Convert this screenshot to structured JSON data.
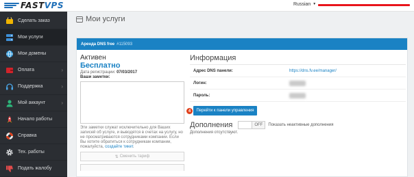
{
  "brand": {
    "logo_prefix": "FAST",
    "logo_suffix": "VPS",
    "accent": "#1a82c4",
    "sidebar_bg": "#2b2e33"
  },
  "header": {
    "language": "Russian",
    "language_caret": "▼"
  },
  "sidebar": {
    "items": [
      {
        "label": "Сделать заказ",
        "icon": "cart-icon",
        "chevron": ""
      },
      {
        "label": "Мои услуги",
        "icon": "server-icon",
        "chevron": ""
      },
      {
        "label": "Мои домены",
        "icon": "globe-icon",
        "chevron": ""
      },
      {
        "label": "Оплата",
        "icon": "wallet-icon",
        "chevron": "›"
      },
      {
        "label": "Поддержка",
        "icon": "headset-icon",
        "chevron": "›"
      },
      {
        "label": "Мой аккаунт",
        "icon": "user-icon",
        "chevron": "›"
      },
      {
        "label": "Начало работы",
        "icon": "rocket-icon",
        "chevron": ""
      },
      {
        "label": "Справка",
        "icon": "lifebuoy-icon",
        "chevron": ""
      },
      {
        "label": "Тех. работы",
        "icon": "gear-icon",
        "chevron": ""
      },
      {
        "label": "Подать жалобу",
        "icon": "thumbs-down-icon",
        "chevron": ""
      }
    ]
  },
  "main": {
    "page_title": "Мои услуги",
    "panel": {
      "heading_service": "Аренда DNS free",
      "heading_id": "#115093",
      "status": "Активен",
      "plan": "Бесплатно",
      "reg_label": "Дата регистрации:",
      "reg_date": "07/03/2017",
      "notes_label": "Ваши заметки:",
      "notes_value": "",
      "notes_help": "Эти заметки служат исключительно для Ваших записей об услуге, и выводятся в счетах на услугу, но не просматриваются сотрудниками компании. Если Вы хотите обратиться к сотрудникам компании, пожалуйста,",
      "notes_help_link": "создайте тикет",
      "notes_help_end": ".",
      "change_plan_label": "Сменить тариф",
      "change_plan_arrow": "⇅",
      "info_title": "Информация",
      "rows": [
        {
          "key": "Адрес DNS панели:",
          "value": "https://dns.fv.ee/manager/"
        },
        {
          "key": "Логин:",
          "value": ""
        },
        {
          "key": "Пароль:",
          "value": ""
        }
      ],
      "panel_button_badge": "4",
      "panel_button_label": "Перейти к панели управления",
      "addons_title": "Дополнения",
      "toggle_state": "OFF",
      "show_inactive_label": "Показать неактивные дополнения",
      "no_addons_text": "Дополнения отсутствуют."
    }
  }
}
